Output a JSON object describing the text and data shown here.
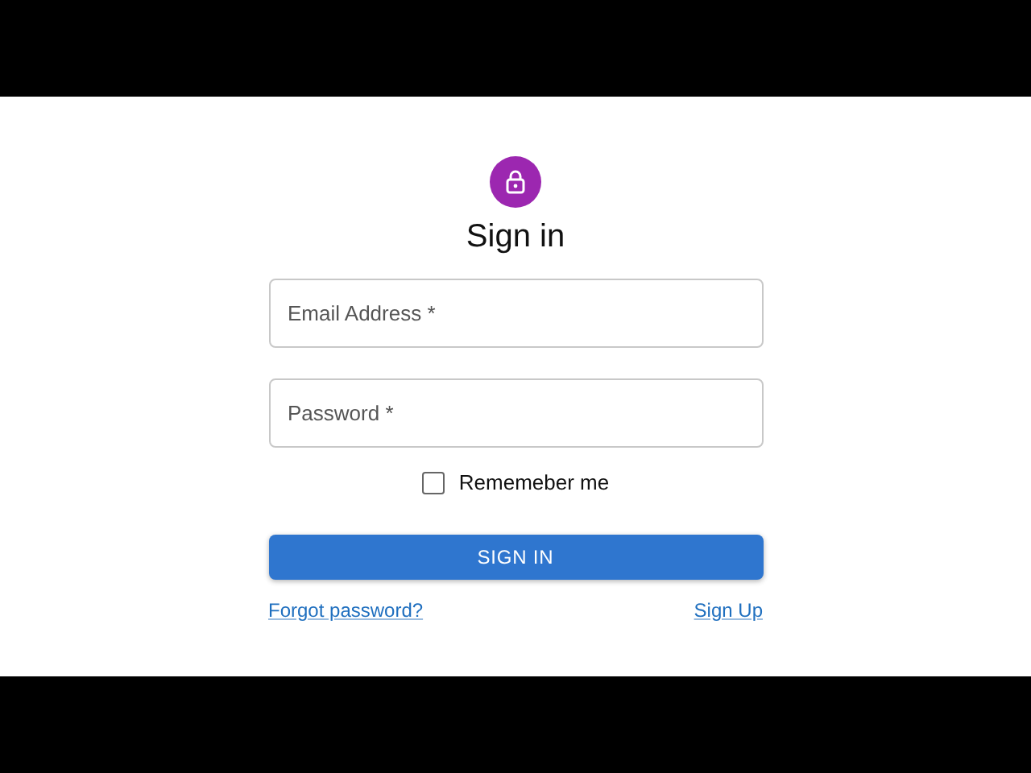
{
  "title": "Sign in",
  "fields": [
    {
      "placeholder": "Email Address *"
    },
    {
      "placeholder": "Password *"
    }
  ],
  "remember": {
    "label": "Rememeber me",
    "checked": false
  },
  "submit": {
    "label": "SIGN IN"
  },
  "links": [
    {
      "label": "Forgot password?"
    },
    {
      "label": "Sign Up"
    }
  ]
}
